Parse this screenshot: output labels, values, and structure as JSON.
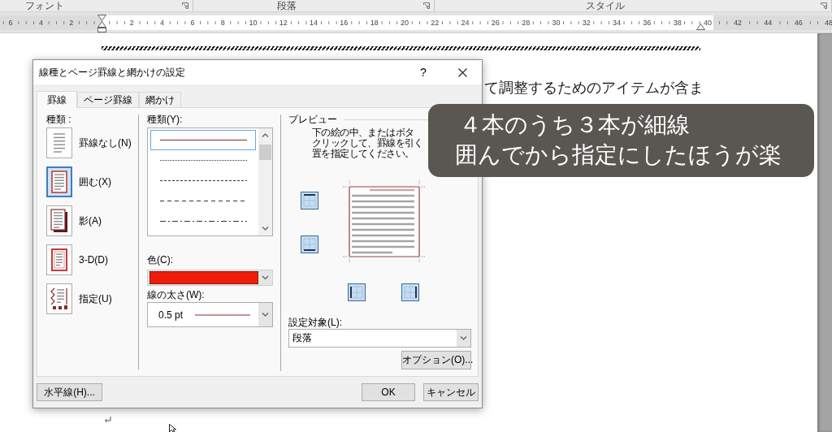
{
  "ribbon_groups": [
    {
      "label": "フォント"
    },
    {
      "label": "段落"
    },
    {
      "label": "スタイル"
    }
  ],
  "ruler": {
    "left_numbers": [
      "6",
      "4",
      "2"
    ],
    "numbers": [
      "2",
      "4",
      "6",
      "8",
      "10",
      "12",
      "14",
      "16",
      "18",
      "20",
      "22",
      "24",
      "26",
      "28",
      "30",
      "32",
      "34",
      "36",
      "38",
      "40"
    ],
    "right_numbers": [
      "42",
      "44",
      "46",
      "48"
    ]
  },
  "document": {
    "text": "て調整するためのアイテムが含ま"
  },
  "dialog": {
    "title": "線種とページ罫線と網かけの設定",
    "help_button": "?",
    "tabs": [
      {
        "label": "罫線",
        "selected": true
      },
      {
        "label": "ページ罫線",
        "selected": false
      },
      {
        "label": "網かけ",
        "selected": false
      }
    ],
    "setting": {
      "label": "種類 :",
      "items": [
        {
          "kind": "none",
          "label": "罫線なし(N)",
          "selected": false
        },
        {
          "kind": "box",
          "label": "囲む(X)",
          "selected": true
        },
        {
          "kind": "shadow",
          "label": "影(A)",
          "selected": false
        },
        {
          "kind": "threed",
          "label": "3-D(D)",
          "selected": false
        },
        {
          "kind": "custom",
          "label": "指定(U)",
          "selected": false
        }
      ]
    },
    "line_style": {
      "label": "種類(Y):",
      "items": [
        {
          "kind": "solid",
          "selected": true
        },
        {
          "kind": "dotted",
          "selected": false
        },
        {
          "kind": "dashed",
          "selected": false
        },
        {
          "kind": "longdash",
          "selected": false
        },
        {
          "kind": "dashdot",
          "selected": false
        }
      ]
    },
    "line_color": {
      "label": "色(C):",
      "color": "#f01c0a"
    },
    "line_width": {
      "label": "線の太さ(W):",
      "value": "0.5 pt"
    },
    "preview": {
      "title": "プレビュー",
      "instructions": [
        "下の絵の中、またはボタ",
        "クリックして、罫線を引く",
        "置を指定してください。"
      ],
      "border_buttons": [
        {
          "kind": "top",
          "on": true
        },
        {
          "kind": "bottom",
          "on": true
        },
        {
          "kind": "left",
          "on": true
        },
        {
          "kind": "right",
          "on": true
        }
      ]
    },
    "apply_to": {
      "label": "設定対象(L):",
      "value": "段落"
    },
    "options_button": "オプション(O)...",
    "horizontal_line_button": "水平線(H)...",
    "ok_button": "OK",
    "cancel_button": "キャンセル"
  },
  "caption": {
    "lines": [
      "４本のうち３本が細線",
      "囲んでから指定にしたほうが楽"
    ]
  }
}
